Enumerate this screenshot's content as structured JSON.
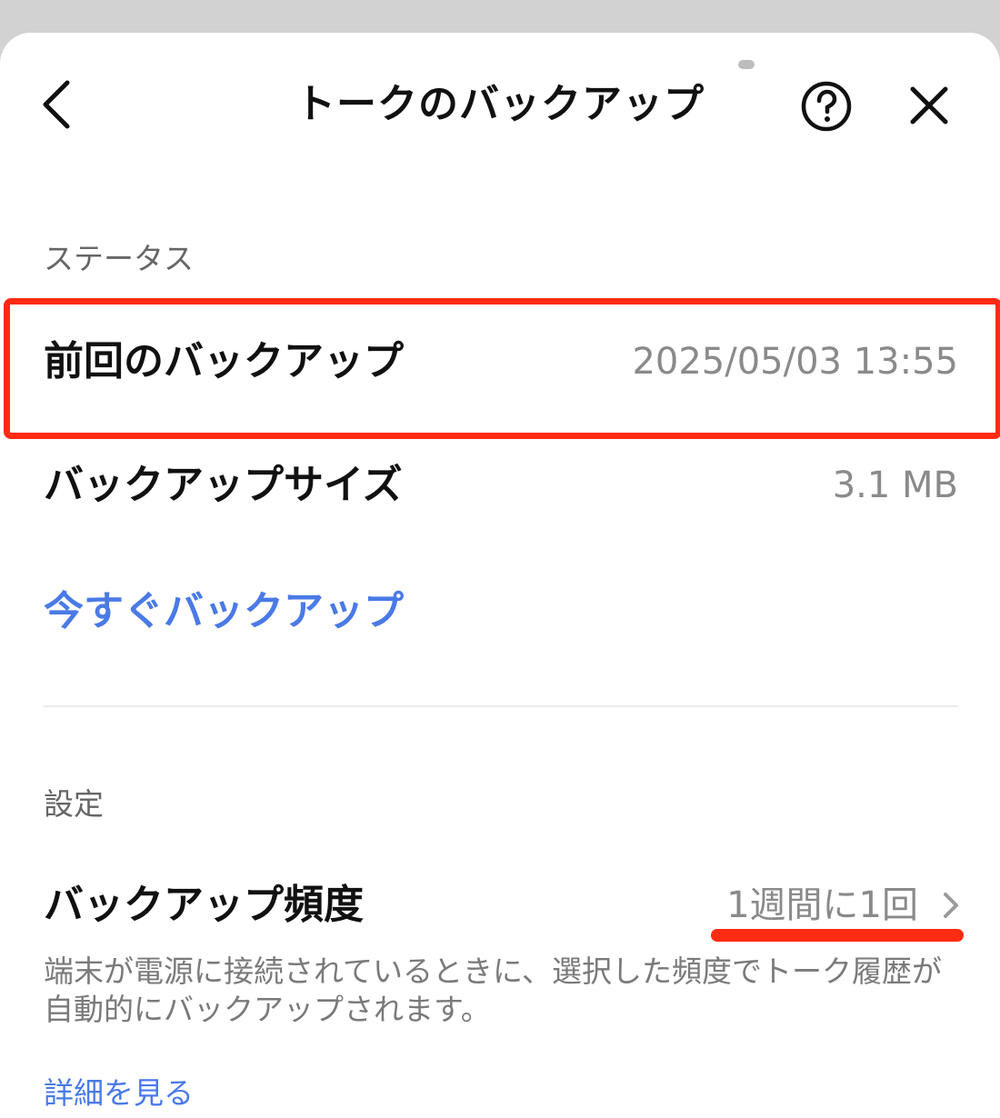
{
  "header": {
    "title": "トークのバックアップ",
    "icons": {
      "back": "chevron-left-icon",
      "help": "question-circle-icon",
      "close": "close-icon"
    }
  },
  "status_section": {
    "label": "ステータス",
    "last_backup": {
      "label": "前回のバックアップ",
      "value": "2025/05/03 13:55"
    },
    "backup_size": {
      "label": "バックアップサイズ",
      "value": "3.1 MB"
    },
    "backup_now_label": "今すぐバックアップ"
  },
  "settings_section": {
    "label": "設定",
    "frequency": {
      "label": "バックアップ頻度",
      "value": "1週間に1回"
    },
    "description": "端末が電源に接続されているときに、選択した頻度でトーク履歴が自動的にバックアップされます。",
    "details_link": "詳細を見る"
  },
  "colors": {
    "accent_link": "#4a7ae6",
    "annotation_red": "#ff2b12"
  }
}
